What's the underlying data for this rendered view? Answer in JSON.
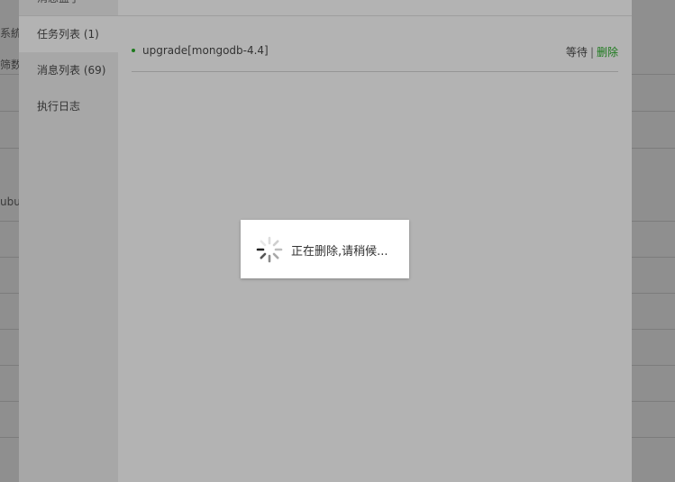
{
  "background": {
    "left_text_1": "系統",
    "left_text_2": "筛数",
    "left_text_3": "ubu"
  },
  "sidebar": {
    "items": [
      {
        "label": "消息盒子"
      },
      {
        "label": "任务列表 (1)"
      },
      {
        "label": "消息列表 (69)"
      },
      {
        "label": "执行日志"
      }
    ]
  },
  "task": {
    "name": "upgrade[mongodb-4.4]",
    "status": "等待",
    "separator": "|",
    "delete_label": "删除"
  },
  "loading": {
    "text": "正在删除,请稍候..."
  },
  "colors": {
    "accent_green": "#1c7a1c",
    "overlay": "#b3b3b3"
  }
}
